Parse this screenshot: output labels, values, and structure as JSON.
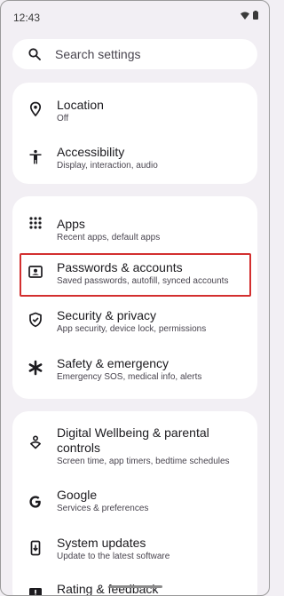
{
  "status_bar": {
    "time": "12:43"
  },
  "search": {
    "placeholder": "Search settings"
  },
  "items": [
    {
      "title": "Location",
      "subtitle": "Off",
      "icon": "location-pin-icon"
    },
    {
      "title": "Accessibility",
      "subtitle": "Display, interaction, audio",
      "icon": "accessibility-person-icon"
    },
    {
      "title": "Apps",
      "subtitle": "Recent apps, default apps",
      "icon": "apps-grid-icon"
    },
    {
      "title": "Passwords & accounts",
      "subtitle": "Saved passwords, autofill, synced accounts",
      "icon": "account-box-icon",
      "highlighted": true
    },
    {
      "title": "Security & privacy",
      "subtitle": "App security, device lock, permissions",
      "icon": "shield-check-icon"
    },
    {
      "title": "Safety & emergency",
      "subtitle": "Emergency SOS, medical info, alerts",
      "icon": "asterisk-icon"
    },
    {
      "title_line1": "Digital Wellbeing & parental",
      "title_line2": "controls",
      "subtitle": "Screen time, app timers, bedtime schedules",
      "icon": "wellbeing-icon"
    },
    {
      "title": "Google",
      "subtitle": "Services & preferences",
      "icon": "google-g-icon"
    },
    {
      "title": "System updates",
      "subtitle": "Update to the latest software",
      "icon": "system-update-icon"
    },
    {
      "title": "Rating & feedback",
      "icon": "feedback-icon"
    }
  ],
  "colors": {
    "background": "#f2eff4",
    "card": "#ffffff",
    "highlight": "#d32f2f"
  }
}
